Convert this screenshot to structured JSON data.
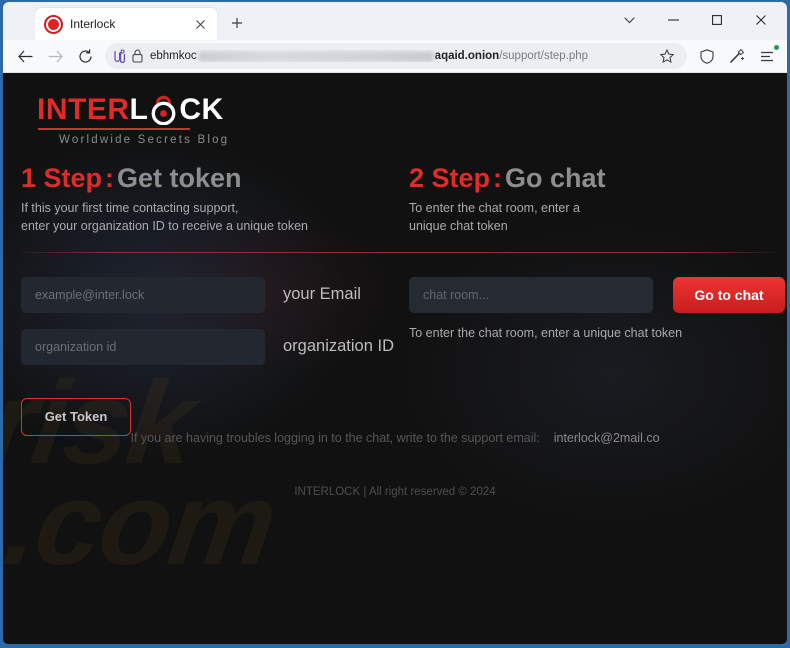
{
  "browser": {
    "tab": {
      "title": "Interlock",
      "favicon": "record-circle-icon",
      "close_icon": "close-icon"
    },
    "new_tab_icon": "plus-icon",
    "window_controls": {
      "tab_list_icon": "chevron-down-icon",
      "minimize_icon": "minimize-icon",
      "maximize_icon": "maximize-icon",
      "close_icon": "close-icon"
    },
    "toolbar": {
      "back_icon": "back-arrow-icon",
      "forward_icon": "forward-arrow-icon",
      "reload_icon": "reload-icon",
      "onion_icon": "onion-routing-icon",
      "site_info_icon": "lock-icon",
      "favorite_icon": "star-icon",
      "shield_icon": "shield-icon",
      "collections_icon": "magic-wand-icon",
      "settings_icon": "settings-menu-icon"
    },
    "url": {
      "prefix": "ebhmkoc",
      "host_suffix": "aqaid.onion",
      "path": "/support/step.php"
    }
  },
  "site": {
    "logo": {
      "part1": "INTER",
      "part2": "L",
      "part3": "CK",
      "lock_icon": "padlock-icon",
      "tagline": "Worldwide Secrets Blog"
    },
    "watermark": {
      "line1": "risk",
      "line2": ".com"
    },
    "steps": [
      {
        "number": "1 Step",
        "colon": ":",
        "title": "Get token",
        "subtitle": "If this your first time contacting support,\nenter your organization ID to receive a unique token"
      },
      {
        "number": "2 Step",
        "colon": ":",
        "title": "Go chat",
        "subtitle": "To enter the chat room, enter a\nunique chat token"
      }
    ],
    "form_left": {
      "email": {
        "placeholder": "example@inter.lock",
        "value": "",
        "label": "your Email"
      },
      "org": {
        "placeholder": "organization id",
        "value": "",
        "label": "organization ID"
      },
      "get_token_label": "Get Token"
    },
    "form_right": {
      "chat": {
        "placeholder": "chat room...",
        "value": ""
      },
      "go_to_chat_label": "Go to chat",
      "hint": "To enter the chat room, enter a unique chat token"
    },
    "support": {
      "text": "If you are having troubles logging in to the chat, write to the support email:",
      "email": "interlock@2mail.co"
    },
    "copyright": "INTERLOCK | All right reserved © 2024"
  },
  "colors": {
    "accent_red": "#e02b2b",
    "button_red": "#d63434",
    "page_bg": "#111111",
    "input_bg": "#232830",
    "window_frame": "#2f6aa8"
  }
}
